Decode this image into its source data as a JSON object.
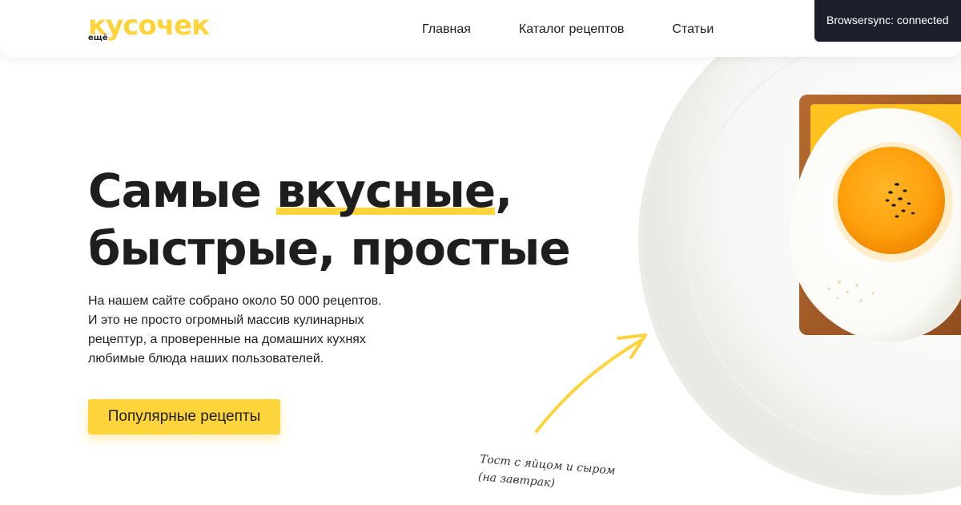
{
  "header": {
    "logo": {
      "main": "кусочек",
      "small": "ещё"
    },
    "nav": [
      {
        "label": "Главная"
      },
      {
        "label": "Каталог рецептов"
      },
      {
        "label": "Статьи"
      }
    ]
  },
  "browsersync": {
    "label": "Browsersync: connected"
  },
  "hero": {
    "title_line1_start": "Самые ",
    "title_highlight": "вкусные",
    "title_line1_end": ",",
    "title_line2": "быстрые, простые",
    "text": [
      "На нашем сайте собрано около 50 000 рецептов.",
      "И это не просто огромный массив кулинарных",
      "рецептур, а проверенные на домашних кухнях",
      "любимые блюда наших пользователей."
    ],
    "cta_label": "Популярные рецепты",
    "caption_line1": "Тост с яйцом и сыром",
    "caption_line2": "(на завтрак)"
  },
  "colors": {
    "accent": "#ffd43b",
    "text": "#1e1e1e",
    "badge": "#1c1f2c"
  }
}
